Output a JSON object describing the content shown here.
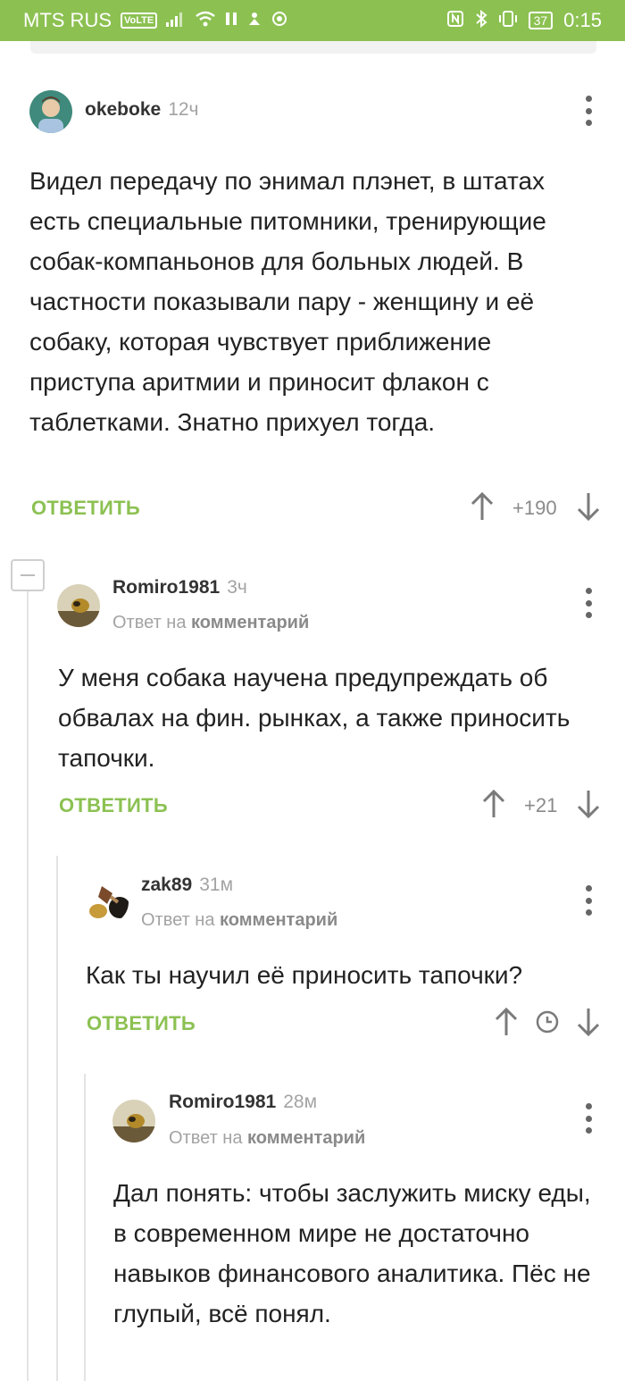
{
  "status_bar": {
    "carrier": "MTS RUS",
    "volte": "VoLTE",
    "battery": "37",
    "time": "0:15"
  },
  "comments": [
    {
      "author": "okeboke",
      "time": "12ч",
      "text": "Видел передачу по энимал плэнет, в штатах есть специальные питомники, тренирующие собак-компаньонов для больных людей. В частности показывали пару - женщину и её собаку, которая чувствует приближение приступа аритмии и приносит флакон с таблетками. Знатно прихуел тогда.",
      "reply_label": "ОТВЕТИТЬ",
      "score": "+190"
    },
    {
      "author": "Romiro1981",
      "time": "3ч",
      "reply_prefix": "Ответ на",
      "reply_target": "комментарий",
      "text": "У меня собака научена предупреждать об обвалах на фин. рынках, а также приносить тапочки.",
      "reply_label": "ОТВЕТИТЬ",
      "score": "+21"
    },
    {
      "author": "zak89",
      "time": "31м",
      "reply_prefix": "Ответ на",
      "reply_target": "комментарий",
      "text": "Как ты научил её приносить тапочки?",
      "reply_label": "ОТВЕТИТЬ"
    },
    {
      "author": "Romiro1981",
      "time": "28м",
      "reply_prefix": "Ответ на",
      "reply_target": "комментарий",
      "text": "Дал понять: чтобы заслужить миску еды, в современном мире не достаточно навыков финансового аналитика. Пёс не глупый, всё понял."
    }
  ],
  "colors": {
    "accent": "#8cc152",
    "muted": "#a3a3a3"
  }
}
